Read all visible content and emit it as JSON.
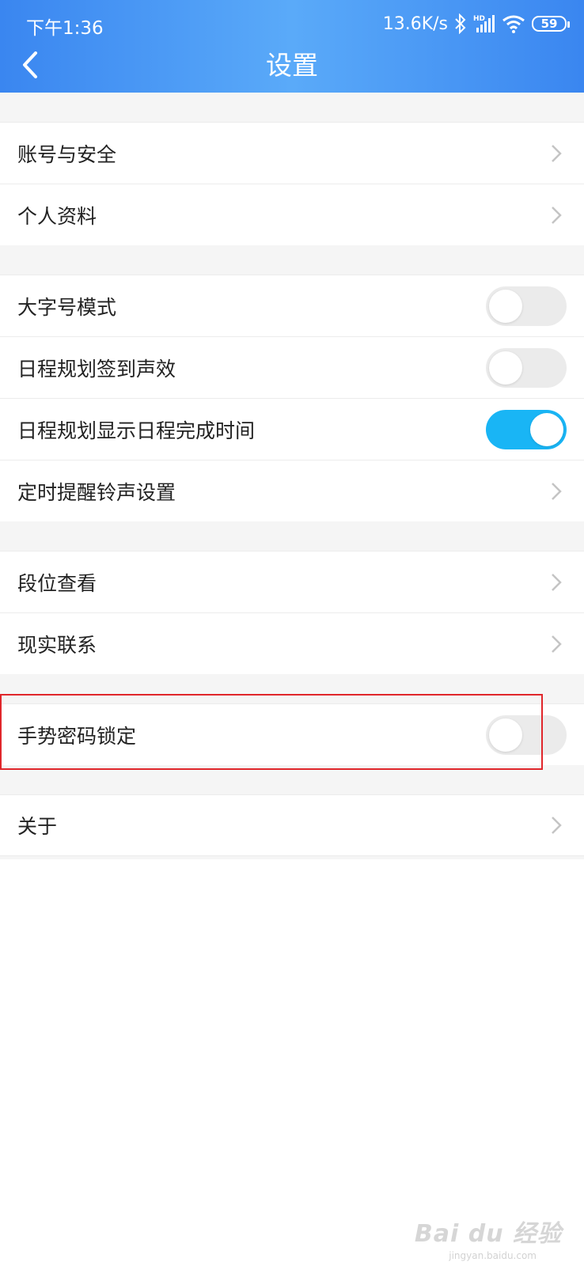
{
  "status_bar": {
    "time": "下午1:36",
    "net_speed": "13.6K/s",
    "battery": "59"
  },
  "header": {
    "title": "设置"
  },
  "settings": {
    "account_security": "账号与安全",
    "profile": "个人资料",
    "large_font_mode": {
      "label": "大字号模式",
      "on": false
    },
    "checkin_sound": {
      "label": "日程规划签到声效",
      "on": false
    },
    "show_completion_time": {
      "label": "日程规划显示日程完成时间",
      "on": true
    },
    "reminder_ringtone": "定时提醒铃声设置",
    "rank_view": "段位查看",
    "contact": "现实联系",
    "gesture_lock": {
      "label": "手势密码锁定",
      "on": false
    },
    "about": "关于"
  },
  "colors": {
    "header_blue": "#3a86f0",
    "toggle_on": "#19b5f5",
    "highlight_red": "#e0262b"
  },
  "watermark": {
    "brand": "Bai du 经验",
    "url": "jingyan.baidu.com"
  }
}
